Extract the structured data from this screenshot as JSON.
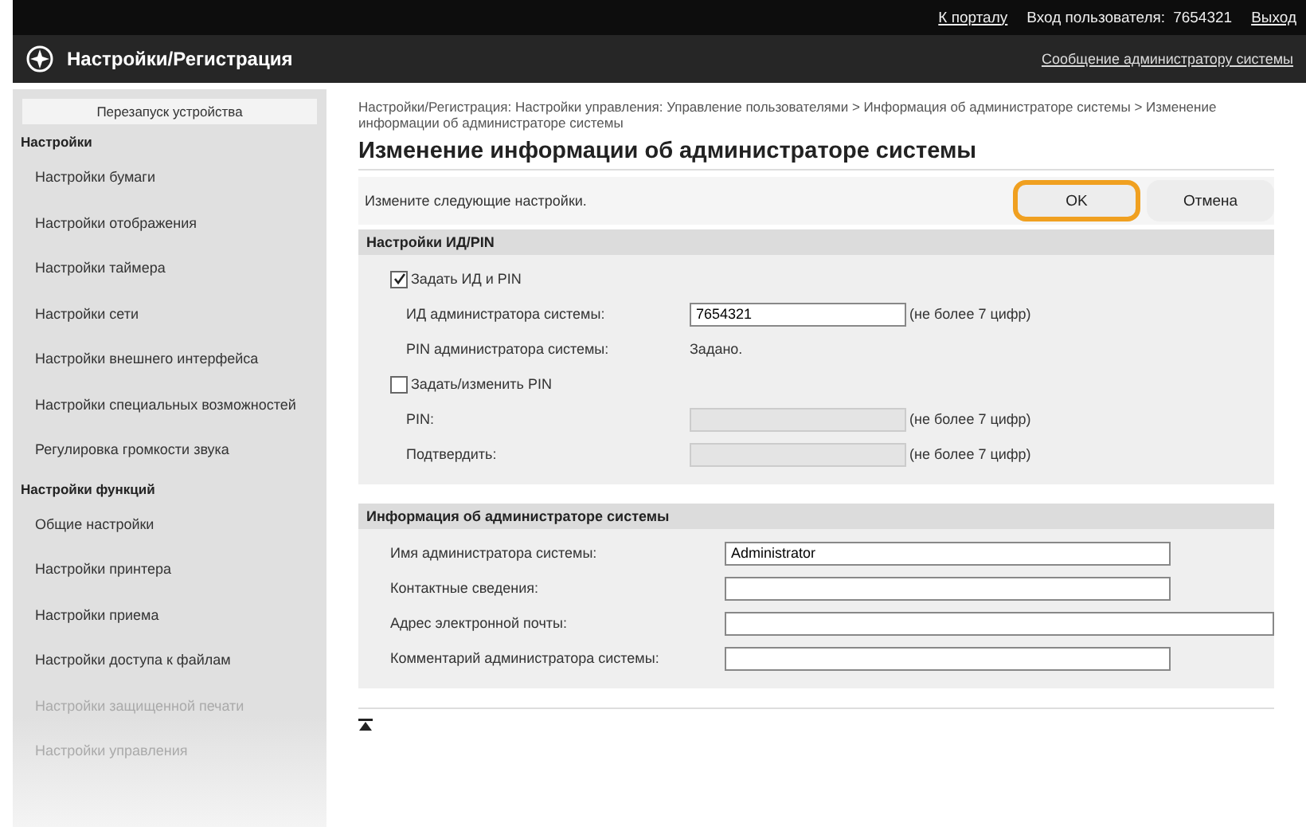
{
  "header": {
    "portal_link": "К порталу",
    "login_label": "Вход пользователя:",
    "login_user": "7654321",
    "logout_link": "Выход",
    "app_title": "Настройки/Регистрация",
    "admin_message_link": "Сообщение администратору системы"
  },
  "sidebar": {
    "restart_button": "Перезапуск устройства",
    "groups": [
      {
        "title": "Настройки",
        "items": [
          {
            "label": "Настройки бумаги",
            "faded": false
          },
          {
            "label": "Настройки отображения",
            "faded": false
          },
          {
            "label": "Настройки таймера",
            "faded": false
          },
          {
            "label": "Настройки сети",
            "faded": false
          },
          {
            "label": "Настройки внешнего интерфейса",
            "faded": false
          },
          {
            "label": "Настройки специальных возможностей",
            "faded": false
          },
          {
            "label": "Регулировка громкости звука",
            "faded": false
          }
        ]
      },
      {
        "title": "Настройки функций",
        "items": [
          {
            "label": "Общие настройки",
            "faded": false
          },
          {
            "label": "Настройки принтера",
            "faded": false
          },
          {
            "label": "Настройки приема",
            "faded": false
          },
          {
            "label": "Настройки доступа к файлам",
            "faded": false
          },
          {
            "label": "Настройки защищенной печати",
            "faded": true
          },
          {
            "label": "Настройки управления",
            "faded": true
          }
        ]
      }
    ]
  },
  "breadcrumb": "Настройки/Регистрация: Настройки управления: Управление пользователями > Информация об администраторе системы > Изменение информации об администраторе системы",
  "page_title": "Изменение информации об администраторе системы",
  "instruction": "Измените следующие настройки.",
  "buttons": [
    {
      "label": "OK",
      "focused": true
    },
    {
      "label": "Отмена",
      "focused": false
    }
  ],
  "sections": [
    {
      "title": "Настройки ИД/PIN",
      "rows": [
        {
          "kind": "checkbox",
          "label": "Задать ИД и PIN",
          "checked": true
        },
        {
          "kind": "input",
          "label": "ИД администратора системы:",
          "value": "7654321",
          "disabled": false,
          "hint": "(не более 7 цифр)"
        },
        {
          "kind": "text",
          "label": "PIN администратора системы:",
          "value": "Задано."
        },
        {
          "kind": "checkbox",
          "label": "Задать/изменить PIN",
          "checked": false
        },
        {
          "kind": "input",
          "label": "PIN:",
          "value": "",
          "disabled": true,
          "hint": "(не более 7 цифр)"
        },
        {
          "kind": "input",
          "label": "Подтвердить:",
          "value": "",
          "disabled": true,
          "hint": "(не более 7 цифр)"
        }
      ]
    },
    {
      "title": "Информация об администраторе системы",
      "rows": [
        {
          "kind": "wide-input",
          "label": "Имя администратора системы:",
          "value": "Administrator",
          "long": false
        },
        {
          "kind": "wide-input",
          "label": "Контактные сведения:",
          "value": "",
          "long": false
        },
        {
          "kind": "wide-input",
          "label": "Адрес электронной почты:",
          "value": "",
          "long": true
        },
        {
          "kind": "wide-input",
          "label": "Комментарий администратора системы:",
          "value": "",
          "long": false
        }
      ]
    }
  ]
}
